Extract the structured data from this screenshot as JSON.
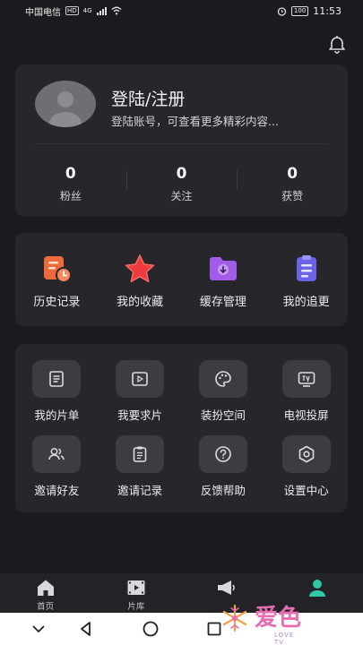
{
  "status_bar": {
    "carrier": "中国电信",
    "net_badge": "HD",
    "signal": "4G",
    "battery": "100",
    "time": "11:53"
  },
  "profile": {
    "title": "登陆/注册",
    "subtitle": "登陆账号，可查看更多精彩内容...",
    "stats": [
      {
        "value": "0",
        "label": "粉丝"
      },
      {
        "value": "0",
        "label": "关注"
      },
      {
        "value": "0",
        "label": "获赞"
      }
    ]
  },
  "quick_actions": [
    {
      "label": "历史记录",
      "icon": "history-icon",
      "color": "#ee6a3a"
    },
    {
      "label": "我的收藏",
      "icon": "star-icon",
      "color": "#ef3b3b"
    },
    {
      "label": "缓存管理",
      "icon": "download-folder-icon",
      "color": "#a25be6"
    },
    {
      "label": "我的追更",
      "icon": "clipboard-icon",
      "color": "#6a63e8"
    }
  ],
  "tools": [
    {
      "label": "我的片单",
      "icon": "list-icon"
    },
    {
      "label": "我要求片",
      "icon": "play-icon"
    },
    {
      "label": "装扮空间",
      "icon": "palette-icon"
    },
    {
      "label": "电视投屏",
      "icon": "tv-icon"
    },
    {
      "label": "邀请好友",
      "icon": "users-icon"
    },
    {
      "label": "邀请记录",
      "icon": "record-icon"
    },
    {
      "label": "反馈帮助",
      "icon": "help-icon"
    },
    {
      "label": "设置中心",
      "icon": "settings-icon"
    }
  ],
  "tabbar": [
    {
      "label": "首页",
      "icon": "home-icon"
    },
    {
      "label": "片库",
      "icon": "film-icon"
    },
    {
      "label": "",
      "icon": "megaphone-icon"
    },
    {
      "label": "",
      "icon": "profile-icon"
    }
  ],
  "watermark": {
    "text": "爱色",
    "sub": "LOVE TV"
  }
}
